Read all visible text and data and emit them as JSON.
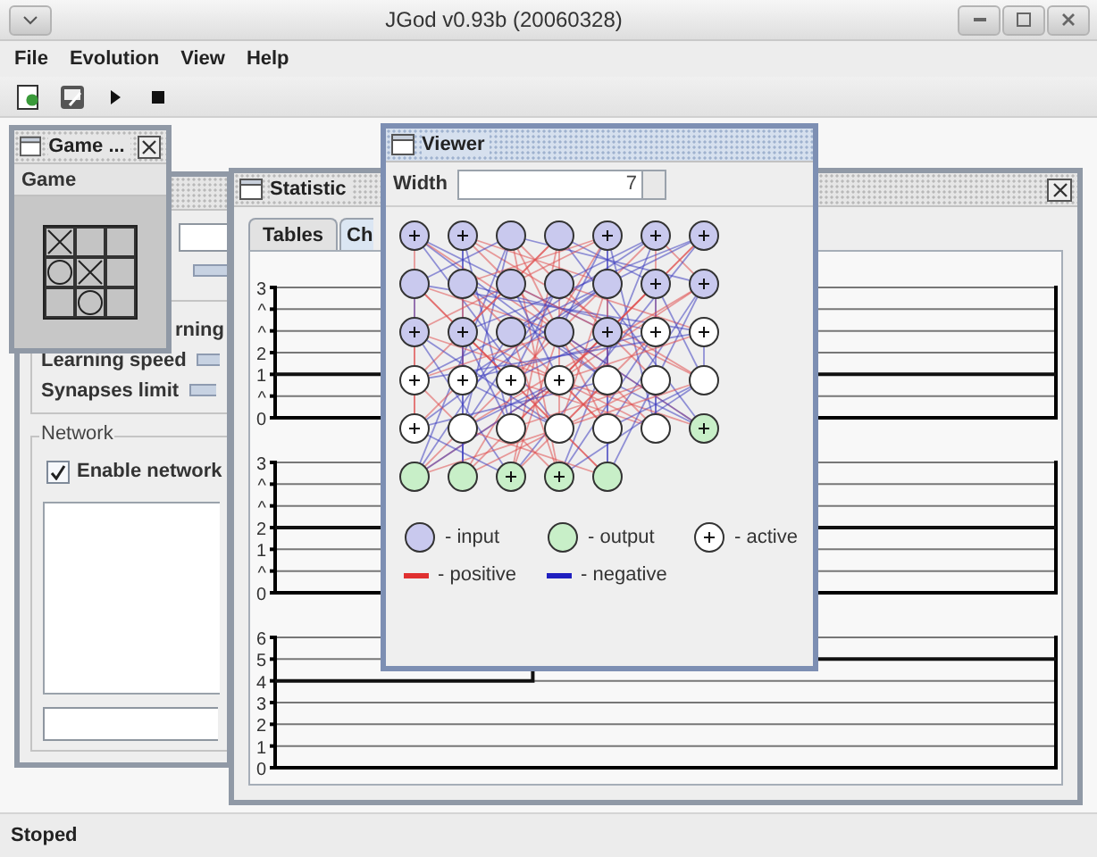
{
  "window": {
    "title": "JGod v0.93b (20060328)"
  },
  "menu": [
    "File",
    "Evolution",
    "View",
    "Help"
  ],
  "toolbar": [
    {
      "kind": "new"
    },
    {
      "kind": "save"
    },
    {
      "kind": "play"
    },
    {
      "kind": "stop"
    }
  ],
  "settings_frame": {
    "learning_label": "rning",
    "speed_label": "Learning speed",
    "synapses_label": "Synapses limit",
    "network_group": "Network",
    "enable_network": {
      "label": "Enable network",
      "checked": true
    }
  },
  "statistic": {
    "title": "Statistic",
    "tabs": [
      {
        "label": "Tables",
        "selected": false
      },
      {
        "label": "Ch",
        "selected": true
      }
    ],
    "charts": [
      {
        "y_labels": [
          "3",
          "^",
          "^",
          "2",
          "1",
          "^",
          "0"
        ]
      },
      {
        "y_labels": [
          "3",
          "^",
          "^",
          "2",
          "1",
          "^",
          "0"
        ]
      },
      {
        "y_labels": [
          "6",
          "5",
          "4",
          "3",
          "2",
          "1",
          "0"
        ]
      }
    ]
  },
  "game": {
    "title": "Game ...",
    "menu": "Game",
    "board": [
      {
        "crossed": true,
        "circled": false
      },
      {
        "crossed": false,
        "circled": false
      },
      {
        "crossed": false,
        "circled": false
      },
      {
        "crossed": false,
        "circled": true
      },
      {
        "crossed": true,
        "circled": false
      },
      {
        "crossed": false,
        "circled": false
      },
      {
        "crossed": false,
        "circled": false
      },
      {
        "crossed": false,
        "circled": true
      },
      {
        "crossed": false,
        "circled": false
      }
    ]
  },
  "viewer": {
    "title": "Viewer",
    "width_label": "Width",
    "width_value": "7",
    "nodes": [
      [
        {
          "kind": "input",
          "active": true
        },
        {
          "kind": "input",
          "active": true
        },
        {
          "kind": "input",
          "active": false
        },
        {
          "kind": "input",
          "active": false
        },
        {
          "kind": "input",
          "active": true
        },
        {
          "kind": "input",
          "active": true
        },
        {
          "kind": "input",
          "active": true
        }
      ],
      [
        {
          "kind": "input",
          "active": false
        },
        {
          "kind": "input",
          "active": false
        },
        {
          "kind": "input",
          "active": false
        },
        {
          "kind": "input",
          "active": false
        },
        {
          "kind": "input",
          "active": false
        },
        {
          "kind": "input",
          "active": true
        },
        {
          "kind": "input",
          "active": true
        }
      ],
      [
        {
          "kind": "input",
          "active": true
        },
        {
          "kind": "input",
          "active": true
        },
        {
          "kind": "input",
          "active": false
        },
        {
          "kind": "input",
          "active": false
        },
        {
          "kind": "input",
          "active": true
        },
        {
          "kind": "hidden",
          "active": true
        },
        {
          "kind": "hidden",
          "active": true
        }
      ],
      [
        {
          "kind": "hidden",
          "active": true
        },
        {
          "kind": "hidden",
          "active": true
        },
        {
          "kind": "hidden",
          "active": true
        },
        {
          "kind": "hidden",
          "active": true
        },
        {
          "kind": "hidden",
          "active": false
        },
        {
          "kind": "hidden",
          "active": false
        },
        {
          "kind": "hidden",
          "active": false
        }
      ],
      [
        {
          "kind": "hidden",
          "active": true
        },
        {
          "kind": "hidden",
          "active": false
        },
        {
          "kind": "hidden",
          "active": false
        },
        {
          "kind": "hidden",
          "active": false
        },
        {
          "kind": "hidden",
          "active": false
        },
        {
          "kind": "hidden",
          "active": false
        },
        {
          "kind": "output",
          "active": true
        }
      ],
      [
        {
          "kind": "output",
          "active": false
        },
        {
          "kind": "output",
          "active": false
        },
        {
          "kind": "output",
          "active": true
        },
        {
          "kind": "output",
          "active": true
        },
        {
          "kind": "output",
          "active": false
        }
      ]
    ],
    "legend": [
      {
        "kind": "input",
        "label": "- input"
      },
      {
        "kind": "output",
        "label": "- output"
      },
      {
        "kind": "active",
        "label": "- active"
      },
      {
        "kind": "positive",
        "label": "- positive"
      },
      {
        "kind": "negative",
        "label": "- negative"
      }
    ]
  },
  "status_bar": "Stoped"
}
